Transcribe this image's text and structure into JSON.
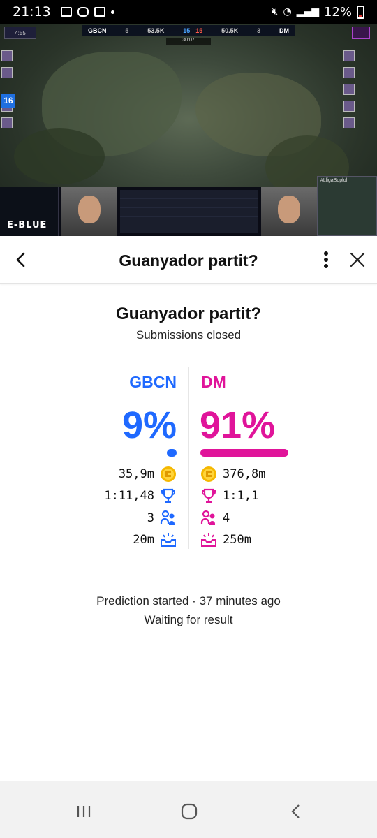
{
  "status_bar": {
    "time": "21:13",
    "battery_text": "12%"
  },
  "stream_overlay": {
    "team_left": "GBCN",
    "team_right": "DM",
    "score_left": "15",
    "score_right": "15",
    "gold_left": "53.5K",
    "gold_right": "50.5K",
    "towers_left": "5",
    "towers_right": "3",
    "timer": "30:07",
    "clock_left": "4:55",
    "side_badge": "16",
    "caster_brand": "E-BLUE",
    "minimap_tag": "#LligaBoplol"
  },
  "header": {
    "title": "Guanyador partit?"
  },
  "prediction": {
    "title": "Guanyador partit?",
    "status": "Submissions closed",
    "outcomes": [
      {
        "name": "GBCN",
        "percent_text": "9%",
        "percent": 9,
        "color": "#1f69ff",
        "points": "35,9m",
        "ratio": "1:11,48",
        "users": "3",
        "top_bet": "20m"
      },
      {
        "name": "DM",
        "percent_text": "91%",
        "percent": 91,
        "color": "#e0149a",
        "points": "376,8m",
        "ratio": "1:1,1",
        "users": "4",
        "top_bet": "250m"
      }
    ],
    "footer_line1": "Prediction started · 37 minutes ago",
    "footer_line2": "Waiting for result"
  },
  "icons": {
    "back": "chevron-left-icon",
    "more": "kebab-menu-icon",
    "close": "close-icon",
    "points": "channel-points-coin-icon",
    "ratio": "trophy-icon",
    "users": "users-icon",
    "top_bet": "top-predictor-icon"
  }
}
